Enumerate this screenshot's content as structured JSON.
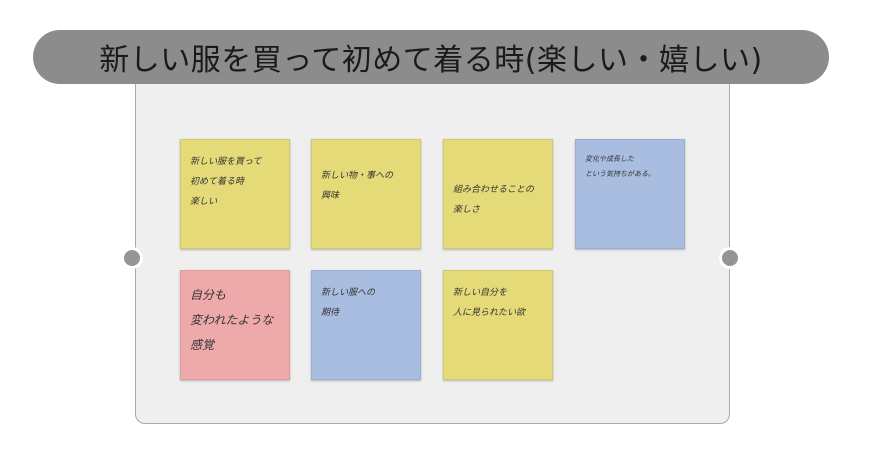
{
  "title": "新しい服を買って初めて着る時(楽しい・嬉しい)",
  "colors": {
    "pill": "#8c8c8c",
    "board": "#efefef",
    "yellow": "#e4db78",
    "blue": "#a8bde0",
    "pink": "#eeaaaa",
    "handle": "#959595"
  },
  "notes": [
    {
      "color": "yellow",
      "text": "新しい服を買って\n初めて着る時\n楽しい"
    },
    {
      "color": "yellow",
      "text": "新しい物・事への\n興味"
    },
    {
      "color": "yellow",
      "text": "組み合わせることの\n楽しさ"
    },
    {
      "color": "blue",
      "text": "変化や成長した\nという気持ちがある。"
    },
    {
      "color": "pink",
      "text": "自分も\n変われたような\n感覚"
    },
    {
      "color": "blue",
      "text": "新しい服への\n期待"
    },
    {
      "color": "yellow",
      "text": "新しい自分を\n人に見られたい欲"
    }
  ]
}
